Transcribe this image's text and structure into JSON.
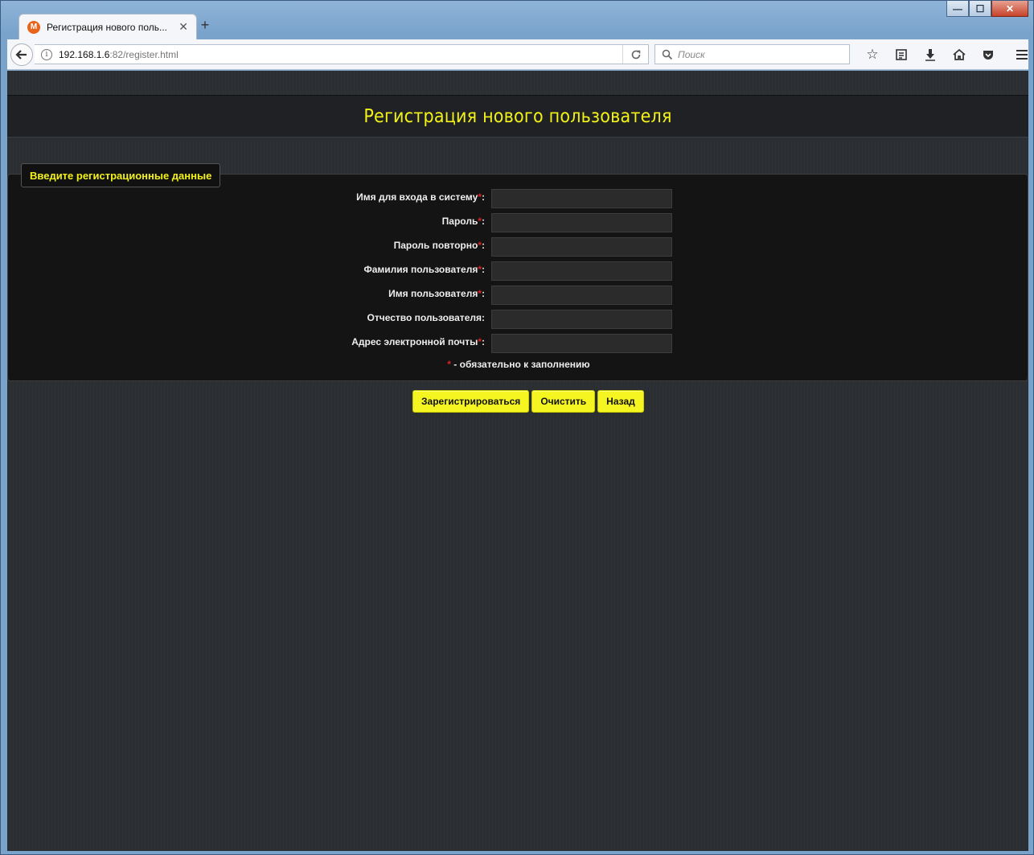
{
  "browser": {
    "tab_title": "Регистрация нового поль...",
    "tab_favicon_letter": "M",
    "tab_close": "✕",
    "new_tab": "+",
    "url_host": "192.168.1.6",
    "url_rest": ":82/register.html",
    "search_placeholder": "Поиск",
    "window_controls": {
      "minimize": "—",
      "maximize": "☐",
      "close": "✕"
    }
  },
  "page": {
    "title": "Регистрация нового пользователя",
    "legend": "Введите регистрационные данные",
    "fields": [
      {
        "label": "Имя для входа в систему",
        "required": true,
        "value": ""
      },
      {
        "label": "Пароль",
        "required": true,
        "value": ""
      },
      {
        "label": "Пароль повторно",
        "required": true,
        "value": ""
      },
      {
        "label": "Фамилия пользователя",
        "required": true,
        "value": ""
      },
      {
        "label": "Имя пользователя",
        "required": true,
        "value": ""
      },
      {
        "label": "Отчество пользователя",
        "required": false,
        "value": ""
      },
      {
        "label": "Адрес электронной почты",
        "required": true,
        "value": ""
      }
    ],
    "required_mark": "*",
    "required_note": " - обязательно к заполнению",
    "buttons": {
      "register": "Зарегистрироваться",
      "clear": "Очистить",
      "back": "Назад"
    }
  },
  "colors": {
    "accent": "#f2f21a",
    "required": "#e12020",
    "background": "#2c2f33"
  }
}
